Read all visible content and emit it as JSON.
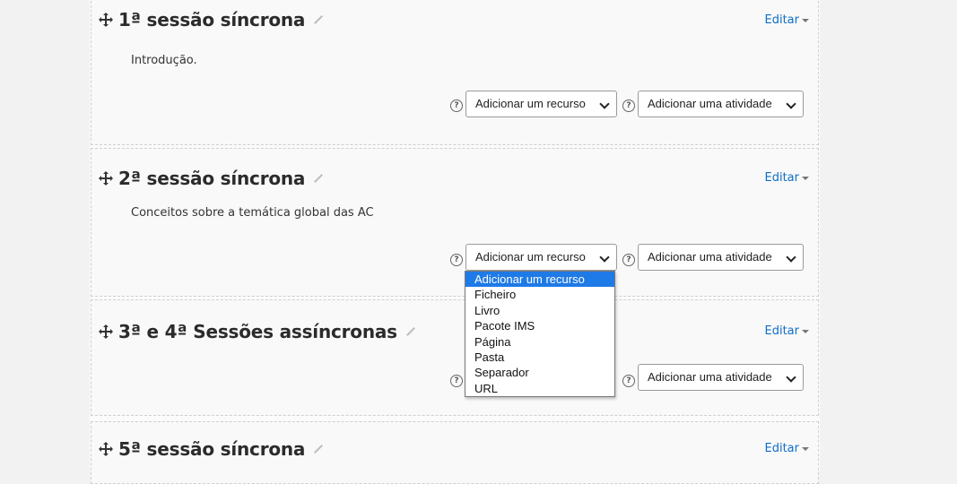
{
  "sections": [
    {
      "title": "1ª sessão síncrona",
      "edit": "Editar",
      "summary": "Introdução.",
      "resource": "Adicionar um recurso",
      "activity": "Adicionar uma atividade"
    },
    {
      "title": "2ª sessão síncrona",
      "edit": "Editar",
      "summary": "Conceitos sobre a temática global das AC",
      "resource": "Adicionar um recurso",
      "activity": "Adicionar uma atividade"
    },
    {
      "title": "3ª e 4ª Sessões assíncronas",
      "edit": "Editar",
      "activity": "Adicionar uma atividade"
    },
    {
      "title": "5ª sessão síncrona",
      "edit": "Editar"
    }
  ],
  "dropdown": {
    "options": [
      "Adicionar um recurso",
      "Ficheiro",
      "Livro",
      "Pacote IMS",
      "Página",
      "Pasta",
      "Separador",
      "URL"
    ],
    "selected_index": 0
  },
  "help_glyph": "?",
  "colors": {
    "link": "#0f6fc5",
    "selected": "#1e7ae6"
  }
}
